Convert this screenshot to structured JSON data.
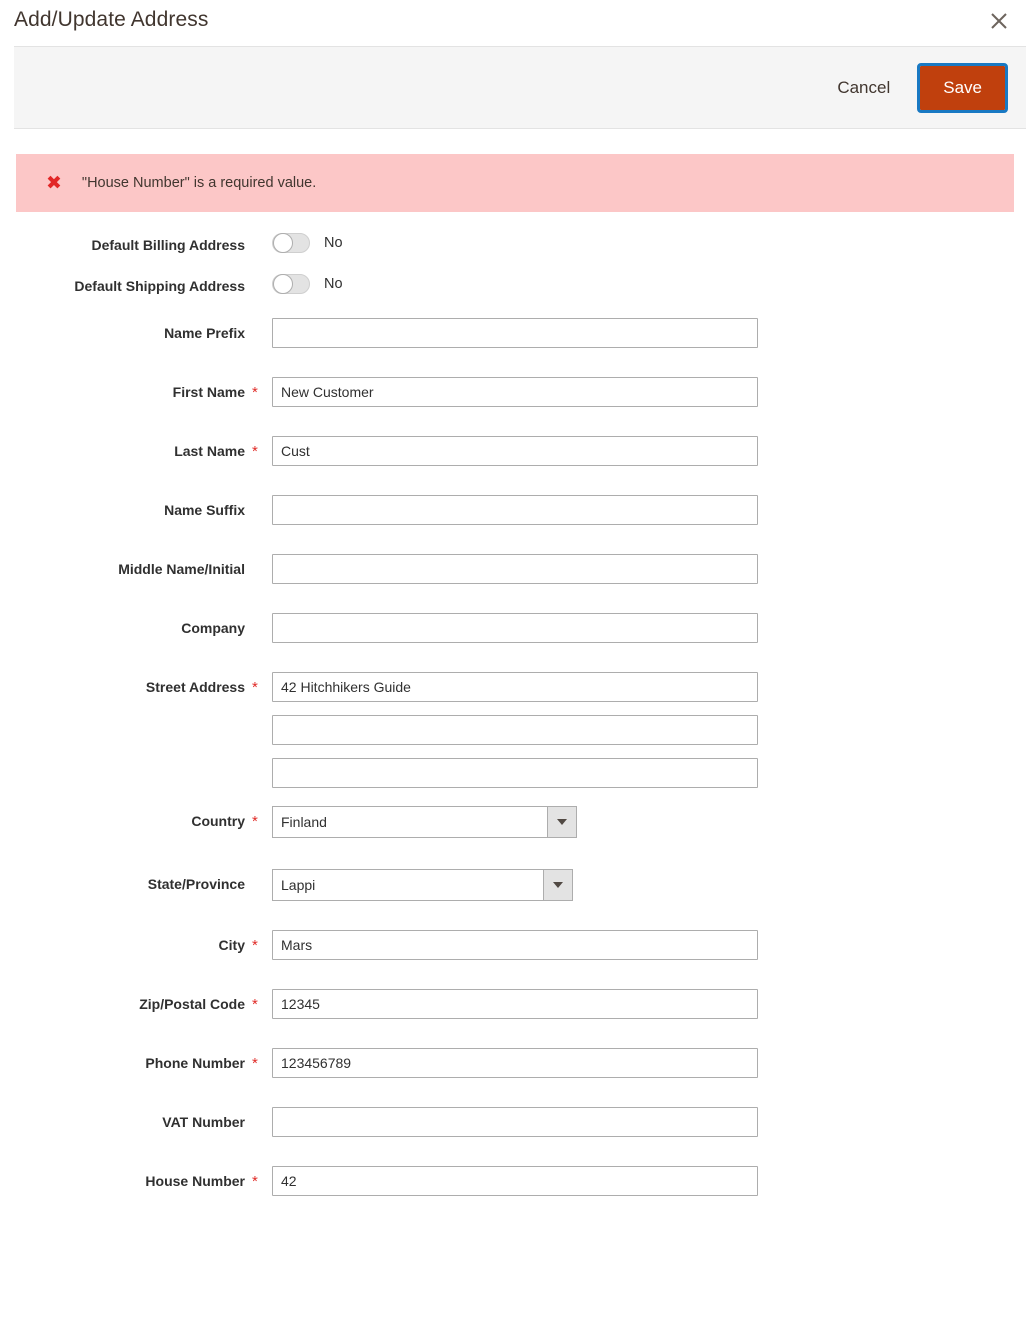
{
  "modal": {
    "title": "Add/Update Address",
    "close_icon": "close-icon"
  },
  "toolbar": {
    "cancel_label": "Cancel",
    "save_label": "Save",
    "save_bg_color": "#c0400d",
    "focus_ring_color": "#1979c3"
  },
  "error": {
    "icon": "error-x-icon",
    "glyph": "✖",
    "message": "\"House Number\" is a required value.",
    "bg_color": "#fcc7c7",
    "icon_color": "#e22626"
  },
  "form": {
    "required_marker": "*",
    "toggles": [
      {
        "label": "Default Billing Address",
        "value": "No",
        "state": "off"
      },
      {
        "label": "Default Shipping Address",
        "value": "No",
        "state": "off"
      }
    ],
    "fields": [
      {
        "label": "Name Prefix",
        "value": "",
        "required": false
      },
      {
        "label": "First Name",
        "value": "New Customer",
        "required": true
      },
      {
        "label": "Last Name",
        "value": "Cust",
        "required": true
      },
      {
        "label": "Name Suffix",
        "value": "",
        "required": false
      },
      {
        "label": "Middle Name/Initial",
        "value": "",
        "required": false
      },
      {
        "label": "Company",
        "value": "",
        "required": false
      }
    ],
    "street": {
      "label": "Street Address",
      "required": true,
      "lines": [
        "42 Hitchhikers Guide",
        "",
        ""
      ]
    },
    "country": {
      "label": "Country",
      "required": true,
      "value": "Finland",
      "arrow_icon": "chevron-down-icon"
    },
    "state": {
      "label": "State/Province",
      "required": false,
      "value": "Lappi",
      "arrow_icon": "chevron-down-icon"
    },
    "fields_tail": [
      {
        "label": "City",
        "value": "Mars",
        "required": true
      },
      {
        "label": "Zip/Postal Code",
        "value": "12345",
        "required": true
      },
      {
        "label": "Phone Number",
        "value": "123456789",
        "required": true
      },
      {
        "label": "VAT Number",
        "value": "",
        "required": false
      },
      {
        "label": "House Number",
        "value": "42",
        "required": true
      }
    ]
  }
}
